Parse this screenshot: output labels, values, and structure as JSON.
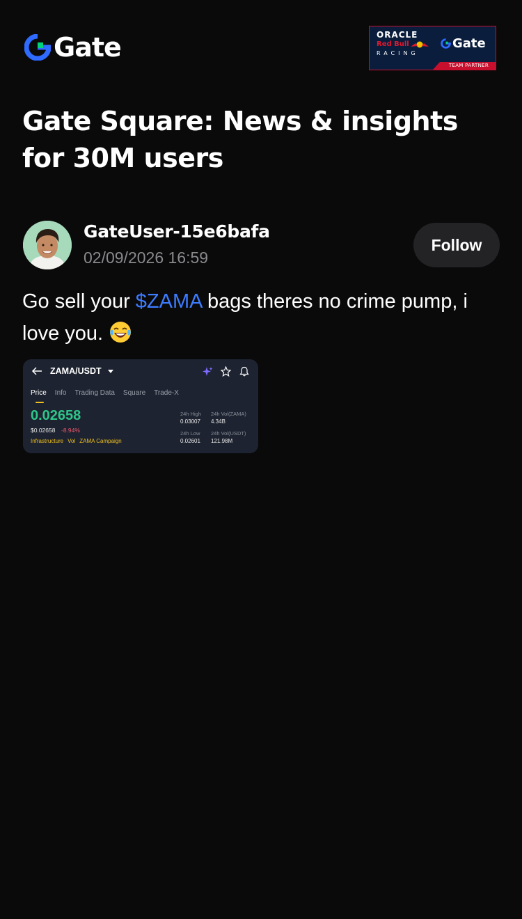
{
  "header": {
    "logo_text": "Gate",
    "partner_banner": {
      "line1": "ORACLE",
      "line2": "Red Bull",
      "line3": "RACING",
      "brand": "Gate",
      "strip": "TEAM PARTNER"
    }
  },
  "page": {
    "title": "Gate Square: News & insights for 30M users"
  },
  "post": {
    "author": "GateUser-15e6bafa",
    "timestamp": "02/09/2026 16:59",
    "follow_label": "Follow",
    "text_before": "Go sell your ",
    "ticker": "$ZAMA",
    "text_after": " bags theres no crime pump, i love you.",
    "emoji": "laughing-with-tears-icon"
  },
  "attached_image": {
    "pair": "ZAMA/USDT",
    "tabs": [
      "Price",
      "Info",
      "Trading Data",
      "Square",
      "Trade-X"
    ],
    "active_tab": "Price",
    "price": "0.02658",
    "usd_price": "$0.02658",
    "change": "-8.94%",
    "tags": [
      "Infrastructure",
      "Vol",
      "ZAMA Campaign"
    ],
    "stats": {
      "high_label": "24h High",
      "high_value": "0.03007",
      "vol_base_label": "24h Vol(ZAMA)",
      "vol_base_value": "4.34B",
      "low_label": "24h Low",
      "low_value": "0.02601",
      "vol_quote_label": "24h Vol(USDT)",
      "vol_quote_value": "121.98M"
    }
  },
  "colors": {
    "background": "#0a0a0b",
    "accent_blue": "#3d7cff",
    "gate_green": "#00d47a",
    "price_green": "#2ec58a",
    "negative_red": "#f0556a",
    "tag_yellow": "#f0c020"
  }
}
